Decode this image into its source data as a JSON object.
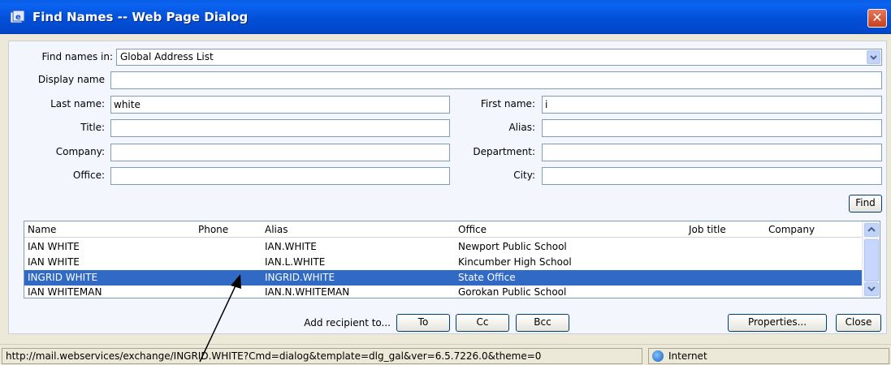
{
  "window": {
    "title": "Find Names -- Web Page Dialog",
    "close_glyph": "✕"
  },
  "form": {
    "find_names_in_label": "Find names in:",
    "find_names_in_value": "Global Address List",
    "display_name_label": "Display name",
    "display_name_value": "",
    "last_name_label": "Last name:",
    "last_name_value": "white",
    "first_name_label": "First name:",
    "first_name_value": "i",
    "title_label": "Title:",
    "title_value": "",
    "alias_label": "Alias:",
    "alias_value": "",
    "company_label": "Company:",
    "company_value": "",
    "department_label": "Department:",
    "department_value": "",
    "office_label": "Office:",
    "office_value": "",
    "city_label": "City:",
    "city_value": "",
    "find_button": "Find"
  },
  "results": {
    "columns": [
      "Name",
      "Phone",
      "Alias",
      "Office",
      "Job title",
      "Company"
    ],
    "rows": [
      {
        "name": "IAN WHITE",
        "phone": "",
        "alias": "IAN.WHITE",
        "office": "Newport Public School",
        "job_title": "",
        "company": "",
        "selected": false
      },
      {
        "name": "IAN WHITE",
        "phone": "",
        "alias": "IAN.L.WHITE",
        "office": "Kincumber High School",
        "job_title": "",
        "company": "",
        "selected": false
      },
      {
        "name": "INGRID WHITE",
        "phone": "",
        "alias": "INGRID.WHITE",
        "office": "State Office",
        "job_title": "",
        "company": "",
        "selected": true
      },
      {
        "name": "IAN WHITEMAN",
        "phone": "",
        "alias": "IAN.N.WHITEMAN",
        "office": "Gorokan Public School",
        "job_title": "",
        "company": "",
        "selected": false
      }
    ]
  },
  "actions": {
    "add_recipient_label": "Add recipient to...",
    "to_button": "To",
    "cc_button": "Cc",
    "bcc_button": "Bcc",
    "properties_button": "Properties...",
    "close_button": "Close"
  },
  "statusbar": {
    "url": "http://mail.webservices/exchange/INGRID.WHITE?Cmd=dialog&template=dlg_gal&ver=6.5.7226.0&theme=0",
    "zone": "Internet"
  },
  "colors": {
    "title_bar": "#0350d8",
    "selection": "#316ac5",
    "dialog_bg": "#ece9d8"
  },
  "icons": [
    "ie-page-icon",
    "close-icon",
    "dropdown-arrow-icon",
    "scroll-up-icon",
    "scroll-down-icon",
    "internet-globe-icon",
    "annotation-arrow"
  ]
}
